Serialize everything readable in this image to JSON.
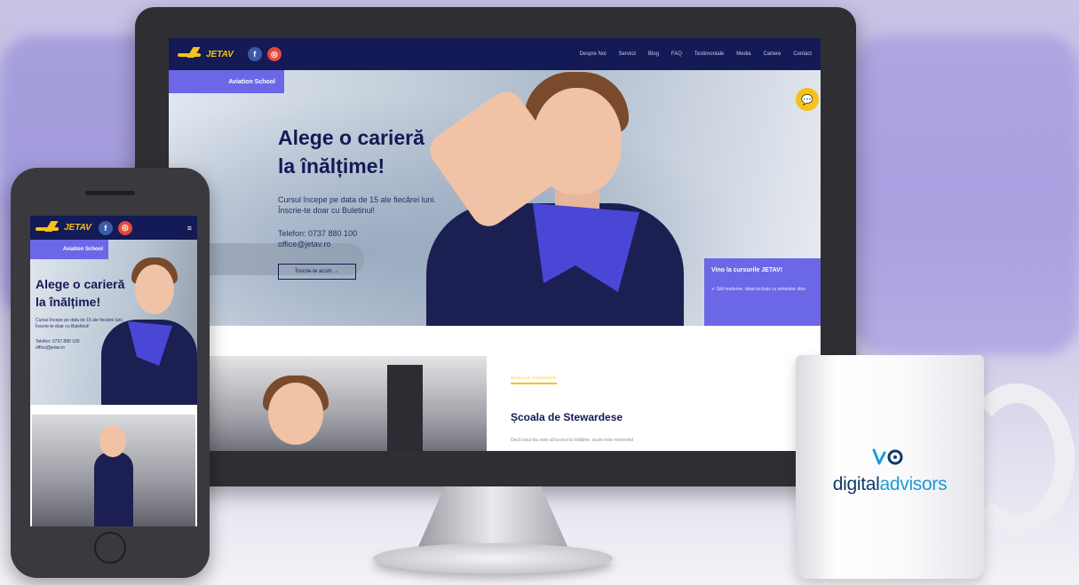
{
  "desktop": {
    "nav": {
      "logo_text": "JETAV",
      "social": [
        {
          "icon": "facebook-icon",
          "glyph": "f"
        },
        {
          "icon": "instagram-icon",
          "glyph": "◎"
        }
      ],
      "menu": [
        "Despre Noi",
        "Servicii",
        "Blog",
        "FAQ",
        "Testimoniale",
        "Media",
        "Cariere",
        "Contact"
      ]
    },
    "hero": {
      "tag": "Aviation School",
      "title_line1": "Alege o carieră",
      "title_line2": "la înălțime!",
      "text": "Cursul începe pe data de 15 ale fiecărei luni. Înscrie-te doar cu Buletinul!",
      "phone": "Telefon: 0737 880 100",
      "email": "office@jetav.ro",
      "button": "Înscrie-te acum →",
      "promo_title": "Vino la cursurile JETAV!",
      "promo_text": "✔ Săli moderne, dotat inclusiv cu simulator zbor"
    },
    "section": {
      "eyebrow": "ȘCOALA DE STEWARDESE",
      "title": "Școala de Stewardese",
      "text": "Dacă visul tău este să lucrezi la înălțime, acum este momentul"
    }
  },
  "phone": {
    "logo_text": "JETAV",
    "hamburger": "≡",
    "tag": "Aviation School",
    "title_line1": "Alege o carieră",
    "title_line2": "la înălțime!",
    "text": "Cursul începe pe data de 15 ale fiecărei luni. Înscrie-te doar cu Buletinul!",
    "phone": "Telefon: 0737 880 100",
    "email": "office@jetav.ro"
  },
  "mug": {
    "brand_part1": "digital",
    "brand_part2": "advisors"
  },
  "colors": {
    "navy": "#141a55",
    "accent": "#6c67e7",
    "yellow": "#f5c21b",
    "brand_dark": "#0e3a6b",
    "brand_light": "#1e9bd7"
  }
}
